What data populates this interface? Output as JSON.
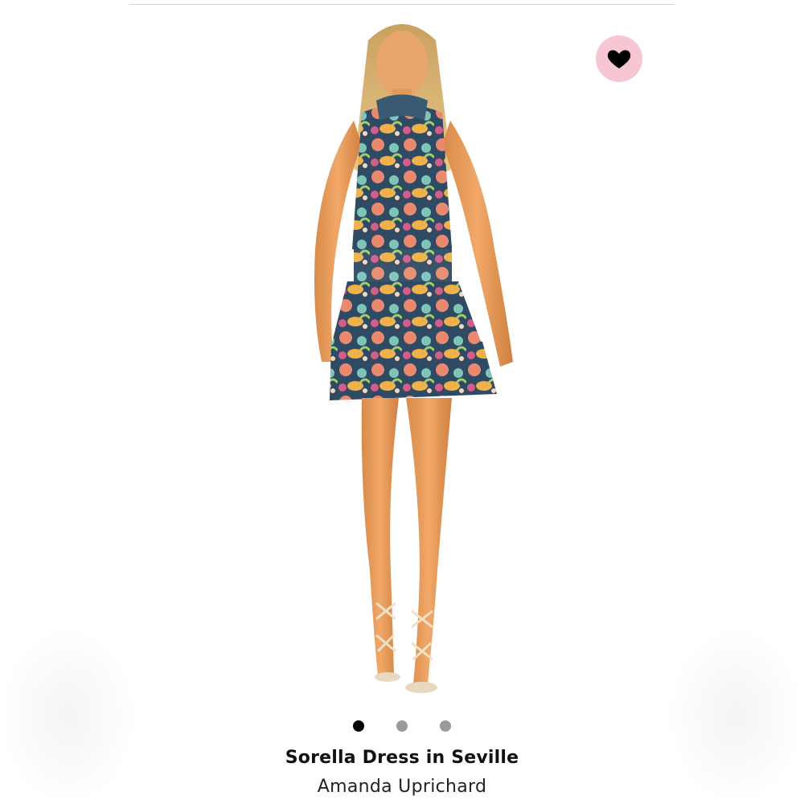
{
  "product": {
    "title": "Sorella Dress in Seville",
    "brand": "Amanda Uprichard"
  },
  "wishlist": {
    "icon": "heart-icon",
    "background_color": "#f7c6d3",
    "icon_color": "#000000"
  },
  "carousel": {
    "total": 3,
    "active_index": 0
  },
  "colors": {
    "dot_active": "#000000",
    "dot_inactive": "#9a9a9a"
  }
}
